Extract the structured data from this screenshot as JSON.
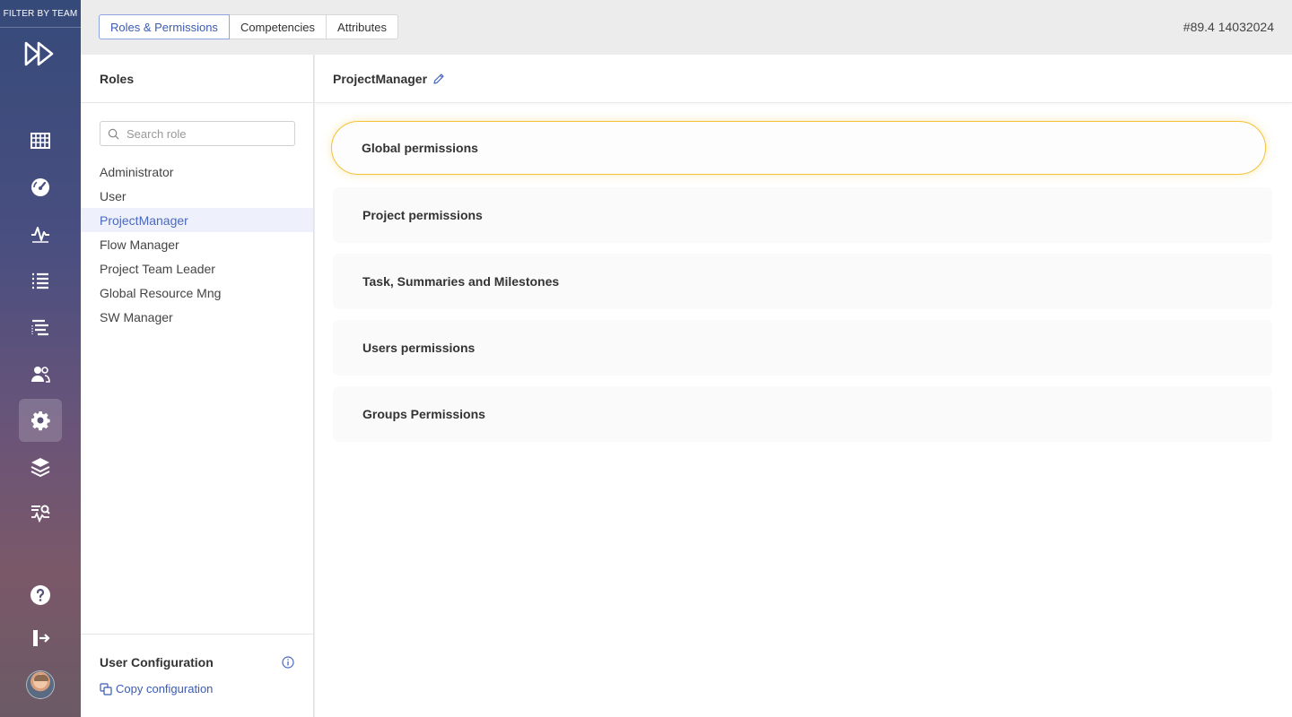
{
  "rail": {
    "filter_label": "FILTER BY TEAM",
    "nav_items": [
      {
        "icon": "calendar-grid-icon"
      },
      {
        "icon": "dashboard-gauge-icon"
      },
      {
        "icon": "activity-pulse-icon"
      },
      {
        "icon": "list-icon"
      },
      {
        "icon": "gantt-list-icon"
      },
      {
        "icon": "users-icon"
      },
      {
        "icon": "gear-icon",
        "active": true
      },
      {
        "icon": "layers-icon"
      },
      {
        "icon": "analytics-search-icon"
      }
    ],
    "bottom_items": [
      {
        "icon": "help-icon"
      },
      {
        "icon": "logout-icon"
      }
    ]
  },
  "topbar": {
    "tabs": [
      {
        "label": "Roles & Permissions",
        "active": true
      },
      {
        "label": "Competencies"
      },
      {
        "label": "Attributes"
      }
    ],
    "version": "#89.4 14032024"
  },
  "roles": {
    "title": "Roles",
    "search_placeholder": "Search role",
    "items": [
      {
        "label": "Administrator"
      },
      {
        "label": "User"
      },
      {
        "label": "ProjectManager",
        "selected": true
      },
      {
        "label": "Flow Manager"
      },
      {
        "label": "Project Team Leader"
      },
      {
        "label": "Global Resource Mng"
      },
      {
        "label": "SW Manager"
      }
    ],
    "user_config": {
      "title": "User Configuration",
      "copy_label": "Copy configuration"
    }
  },
  "main": {
    "role_name": "ProjectManager",
    "sections": [
      {
        "label": "Global permissions",
        "focused": true
      },
      {
        "label": "Project permissions"
      },
      {
        "label": "Task, Summaries and Milestones"
      },
      {
        "label": "Users permissions"
      },
      {
        "label": "Groups Permissions"
      }
    ]
  },
  "colors": {
    "accent": "#3b5bb5",
    "focus_ring": "#f3c23a",
    "selected_row": "#eef1fb"
  }
}
